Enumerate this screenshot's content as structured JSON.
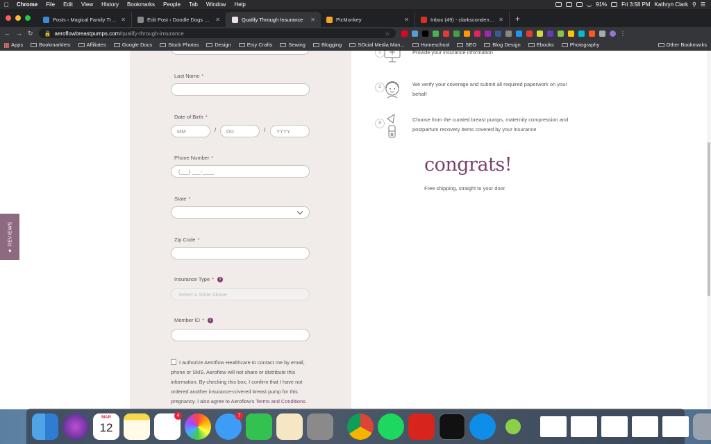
{
  "menubar": {
    "app_name": "Chrome",
    "menus": [
      "File",
      "Edit",
      "View",
      "History",
      "Bookmarks",
      "People",
      "Tab",
      "Window",
      "Help"
    ],
    "battery": "91%",
    "clock": "Fri 3:58 PM",
    "user": "Kathryn Clark"
  },
  "tabs": [
    {
      "title": "Posts ‹ Magical Family Travel C",
      "favicon_color": "#3c8bd9"
    },
    {
      "title": "Edit Post ‹ Doodle Dogs 101 —",
      "favicon_color": "#888888"
    },
    {
      "title": "Qualify Through Insurance",
      "favicon_color": "#f0e0e6",
      "active": true
    },
    {
      "title": "PicMonkey",
      "favicon_color": "#f6a623"
    },
    {
      "title": "Inbox (49) - clarkscondensed",
      "favicon_color": "#d93025"
    }
  ],
  "address_bar": {
    "domain": "aeroflowbreastpumps.com",
    "path": "/qualify-through-insurance"
  },
  "bookmarks": {
    "apps": "Apps",
    "items": [
      "Bookmarklets",
      "Affiliates",
      "Google Docs",
      "Stock Photos",
      "Design",
      "Etsy Crafts",
      "Sewing",
      "Blogging",
      "SOcial Media Man...",
      "Homeschool",
      "SEO",
      "Blog Design",
      "Ebooks",
      "Photography"
    ],
    "other": "Other Bookmarks"
  },
  "form": {
    "last_name": {
      "label": "Last Name",
      "required": "*",
      "value": ""
    },
    "dob": {
      "label": "Date of Birth",
      "required": "*",
      "mm": "MM",
      "dd": "DD",
      "yyyy": "YYYY",
      "slash": "/"
    },
    "phone": {
      "label": "Phone Number",
      "required": "*",
      "placeholder": "(___) ___-____"
    },
    "state": {
      "label": "State",
      "required": "*",
      "value": ""
    },
    "zip": {
      "label": "Zip Code",
      "required": "*",
      "value": ""
    },
    "insurance": {
      "label": "Insurance Type",
      "required": "*",
      "placeholder": "Select a State Above"
    },
    "member_id": {
      "label": "Member ID",
      "required": "*",
      "value": ""
    },
    "info_icon": "i",
    "consent_text": "I authorize Aeroflow Healthcare to contact me by email, phone or SMS. Aeroflow will not share or distribute this information. By checking this box, I confirm that I have not ordered another insurance-covered breast pump for this pregnancy. I also agree to Aeroflow's",
    "consent_link": "Terms and Conditions."
  },
  "reviews_tab": "★ REVIEWS",
  "steps": [
    {
      "num": "1",
      "text": "Provide your insurance information"
    },
    {
      "num": "2",
      "text": "We verify your coverage and submit all required paperwork on your behalf"
    },
    {
      "num": "3",
      "text": "Choose from the curated breast pumps, maternity compression and postpartum recovery items covered by your insurance"
    }
  ],
  "congrats": {
    "title": "congrats!",
    "subtitle": "Free shipping, straight to your door."
  },
  "dock": {
    "calendar_month": "MAR",
    "calendar_day": "12",
    "reminders_badge": "4",
    "messages_badge": "7"
  },
  "colors": {
    "accent": "#7b3f6e",
    "panel": "#f1ecea"
  }
}
